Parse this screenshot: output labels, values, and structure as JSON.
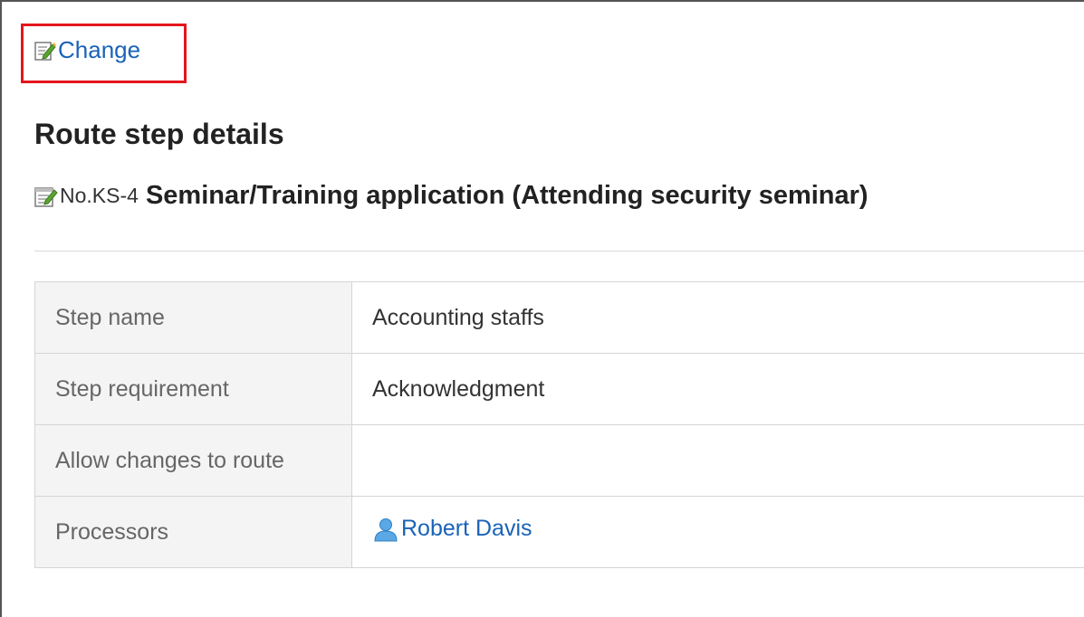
{
  "toolbar": {
    "change_label": "Change"
  },
  "page": {
    "title": "Route step details"
  },
  "subject": {
    "number": "No.KS-4",
    "title": "Seminar/Training application (Attending security seminar)"
  },
  "details": {
    "rows": [
      {
        "label": "Step name",
        "value": "Accounting staffs"
      },
      {
        "label": "Step requirement",
        "value": "Acknowledgment"
      },
      {
        "label": "Allow changes to route",
        "value": ""
      },
      {
        "label": "Processors",
        "value": "Robert Davis"
      }
    ]
  },
  "icons": {
    "change": "edit-icon",
    "subject": "form-icon",
    "processor": "user-icon"
  },
  "colors": {
    "link": "#1a63b8",
    "highlight_box": "#e4161d",
    "label_background": "#f4f4f4",
    "border": "#d5d5d5"
  }
}
